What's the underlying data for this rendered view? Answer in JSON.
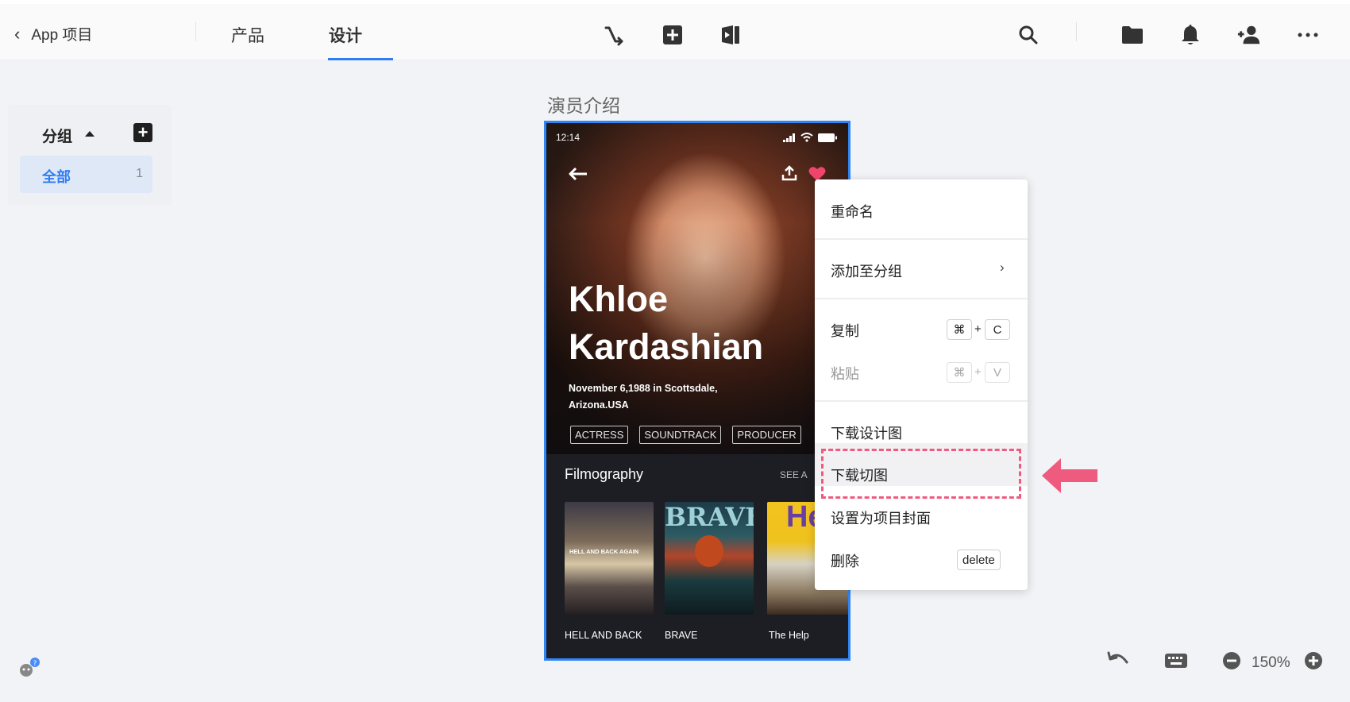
{
  "topbar": {
    "back_label": "App 项目",
    "tabs": [
      "产品",
      "设计"
    ],
    "active_tab": "设计",
    "accent": "#2f7cf6"
  },
  "sidebar": {
    "group_title": "分组",
    "items": [
      {
        "label": "全部",
        "count": "1"
      }
    ]
  },
  "artboard": {
    "title": "演员介绍",
    "status_time": "12:14",
    "actor_name": "Khloe Kardashian",
    "actor_bio": "November 6,1988 in Scottsdale, Arizona.USA",
    "tags": [
      "ACTRESS",
      "SOUNDTRACK",
      "PRODUCER"
    ],
    "section_title": "Filmography",
    "see_all": "SEE A",
    "films": [
      "HELL AND BACK",
      "BRAVE",
      "The Help"
    ],
    "poster_texts": [
      "HELL AND BACK AGAIN",
      "BRAVE",
      "He"
    ]
  },
  "context_menu": {
    "rename": "重命名",
    "add_to_group": "添加至分组",
    "copy": "复制",
    "paste": "粘贴",
    "download_design": "下载设计图",
    "download_slices": "下载切图",
    "set_cover": "设置为项目封面",
    "delete": "删除",
    "cmd_symbol": "⌘",
    "plus": "+",
    "key_c": "C",
    "key_v": "V",
    "delete_key": "delete",
    "submenu_arrow": "›"
  },
  "zoom": {
    "value": "150%"
  },
  "colors": {
    "highlight": "#ee5b7e",
    "artboard_border": "#2f86f6"
  }
}
